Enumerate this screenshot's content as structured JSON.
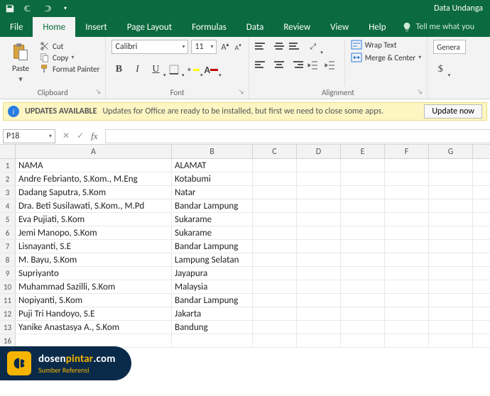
{
  "titlebar": {
    "title": "Data Undanga"
  },
  "tabs": {
    "file": "File",
    "home": "Home",
    "insert": "Insert",
    "pageLayout": "Page Layout",
    "formulas": "Formulas",
    "data": "Data",
    "review": "Review",
    "view": "View",
    "help": "Help",
    "tellme": "Tell me what you"
  },
  "ribbon": {
    "clipboard": {
      "paste": "Paste",
      "cut": "Cut",
      "copy": "Copy",
      "formatPainter": "Format Painter",
      "label": "Clipboard"
    },
    "font": {
      "name": "Calibri",
      "size": "11",
      "label": "Font"
    },
    "alignment": {
      "wrap": "Wrap Text",
      "merge": "Merge & Center",
      "label": "Alignment"
    },
    "number": {
      "format": "Genera"
    }
  },
  "notify": {
    "title": "UPDATES AVAILABLE",
    "msg": "Updates for Office are ready to be installed, but first we need to close some apps.",
    "button": "Update now"
  },
  "formulaBar": {
    "nameBox": "P18",
    "fx": "fx",
    "formula": ""
  },
  "grid": {
    "columns": [
      "A",
      "B",
      "C",
      "D",
      "E",
      "F",
      "G"
    ],
    "headers": {
      "A": "NAMA",
      "B": "ALAMAT"
    },
    "rows": [
      {
        "n": 1,
        "A": "NAMA",
        "B": "ALAMAT"
      },
      {
        "n": 2,
        "A": "Andre Febrianto, S.Kom., M.Eng",
        "B": "Kotabumi"
      },
      {
        "n": 3,
        "A": "Dadang Saputra, S.Kom",
        "B": "Natar"
      },
      {
        "n": 4,
        "A": "Dra. Beti Susilawati, S.Kom., M.Pd",
        "B": "Bandar Lampung"
      },
      {
        "n": 5,
        "A": "Eva Pujiati, S.Kom",
        "B": "Sukarame"
      },
      {
        "n": 6,
        "A": "Jemi Manopo, S.Kom",
        "B": "Sukarame"
      },
      {
        "n": 7,
        "A": "Lisnayanti, S.E",
        "B": "Bandar Lampung"
      },
      {
        "n": 8,
        "A": "M. Bayu, S.Kom",
        "B": "Lampung Selatan"
      },
      {
        "n": 9,
        "A": "Supriyanto",
        "B": "Jayapura"
      },
      {
        "n": 10,
        "A": "Muhammad Sazilli, S.Kom",
        "B": "Malaysia"
      },
      {
        "n": 11,
        "A": "Nopiyanti, S.Kom",
        "B": "Bandar Lampung"
      },
      {
        "n": 12,
        "A": "Puji Tri Handoyo, S.E",
        "B": "Jakarta"
      },
      {
        "n": 13,
        "A": "Yanike Anastasya A., S.Kom",
        "B": "Bandung"
      },
      {
        "n": 16,
        "A": "",
        "B": ""
      }
    ]
  },
  "watermark": {
    "brand1": "dosen",
    "brand2": "pintar",
    "brand3": ".com",
    "sub": "Sumber Referensi"
  }
}
